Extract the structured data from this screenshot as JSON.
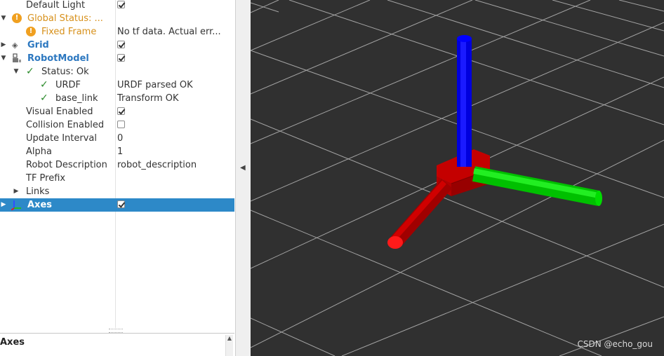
{
  "tree": {
    "default_light": {
      "label": "Default Light",
      "checked": true
    },
    "global_status": {
      "label": "Global Status: ...",
      "icon": "warning-icon"
    },
    "fixed_frame": {
      "label": "Fixed Frame",
      "value": "No tf data.  Actual err..."
    },
    "grid": {
      "label": "Grid",
      "checked": true
    },
    "robot_model": {
      "label": "RobotModel",
      "checked": true
    },
    "status_ok": {
      "label": "Status: Ok"
    },
    "urdf": {
      "label": "URDF",
      "value": "URDF parsed OK"
    },
    "base_link": {
      "label": "base_link",
      "value": "Transform OK"
    },
    "visual_enabled": {
      "label": "Visual Enabled",
      "checked": true
    },
    "collision_enabled": {
      "label": "Collision Enabled",
      "checked": false
    },
    "update_interval": {
      "label": "Update Interval",
      "value": "0"
    },
    "alpha": {
      "label": "Alpha",
      "value": "1"
    },
    "robot_description": {
      "label": "Robot Description",
      "value": "robot_description"
    },
    "tf_prefix": {
      "label": "TF Prefix"
    },
    "links": {
      "label": "Links"
    },
    "axes": {
      "label": "Axes",
      "checked": true
    }
  },
  "description_panel": {
    "title": "Axes"
  },
  "viewport": {
    "background": "#303030",
    "grid_color": "#a0a0a0",
    "x_axis_color": "#cc0000",
    "y_axis_color": "#00dd00",
    "z_axis_color": "#0000ee",
    "watermark": "CSDN @echo_gou"
  },
  "colors": {
    "selection": "#2d89c8",
    "warning": "#f0a020",
    "link_blue": "#2d78c0",
    "ok_green": "#2a8a2a"
  }
}
